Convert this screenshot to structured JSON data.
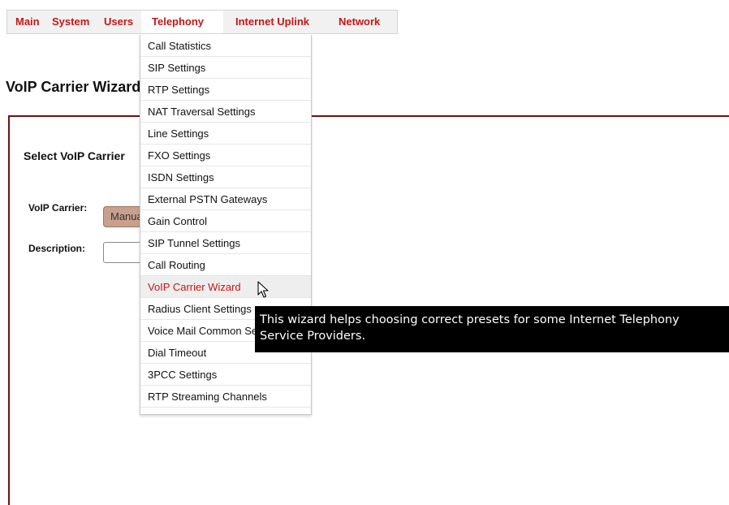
{
  "nav": {
    "items": [
      {
        "label": "Main"
      },
      {
        "label": "System"
      },
      {
        "label": "Users"
      },
      {
        "label": "Telephony"
      },
      {
        "label": "Internet Uplink"
      },
      {
        "label": "Network"
      }
    ]
  },
  "page": {
    "title": "VoIP Carrier Wizard",
    "section_title": "Select VoIP Carrier",
    "carrier_label": "VoIP Carrier:",
    "carrier_value": "Manual",
    "description_label": "Description:",
    "description_value": ""
  },
  "dropdown": {
    "items": [
      {
        "label": "Call Statistics"
      },
      {
        "label": "SIP Settings"
      },
      {
        "label": "RTP Settings"
      },
      {
        "label": "NAT Traversal Settings"
      },
      {
        "label": "Line Settings"
      },
      {
        "label": "FXO Settings"
      },
      {
        "label": "ISDN Settings"
      },
      {
        "label": "External PSTN Gateways"
      },
      {
        "label": "Gain Control"
      },
      {
        "label": "SIP Tunnel Settings"
      },
      {
        "label": "Call Routing"
      },
      {
        "label": "VoIP Carrier Wizard"
      },
      {
        "label": "Radius Client Settings"
      },
      {
        "label": "Voice Mail Common Settings"
      },
      {
        "label": "Dial Timeout"
      },
      {
        "label": "3PCC Settings"
      },
      {
        "label": "RTP Streaming Channels"
      }
    ],
    "hovered": "VoIP Carrier Wizard"
  },
  "tooltip": {
    "text": "This wizard helps choosing correct presets for some Internet Telephony Service Providers."
  },
  "colors": {
    "nav_text": "#c21717",
    "panel_border": "#6b1414",
    "tooltip_bg": "#000000",
    "select_bg": "#c9a08c"
  }
}
